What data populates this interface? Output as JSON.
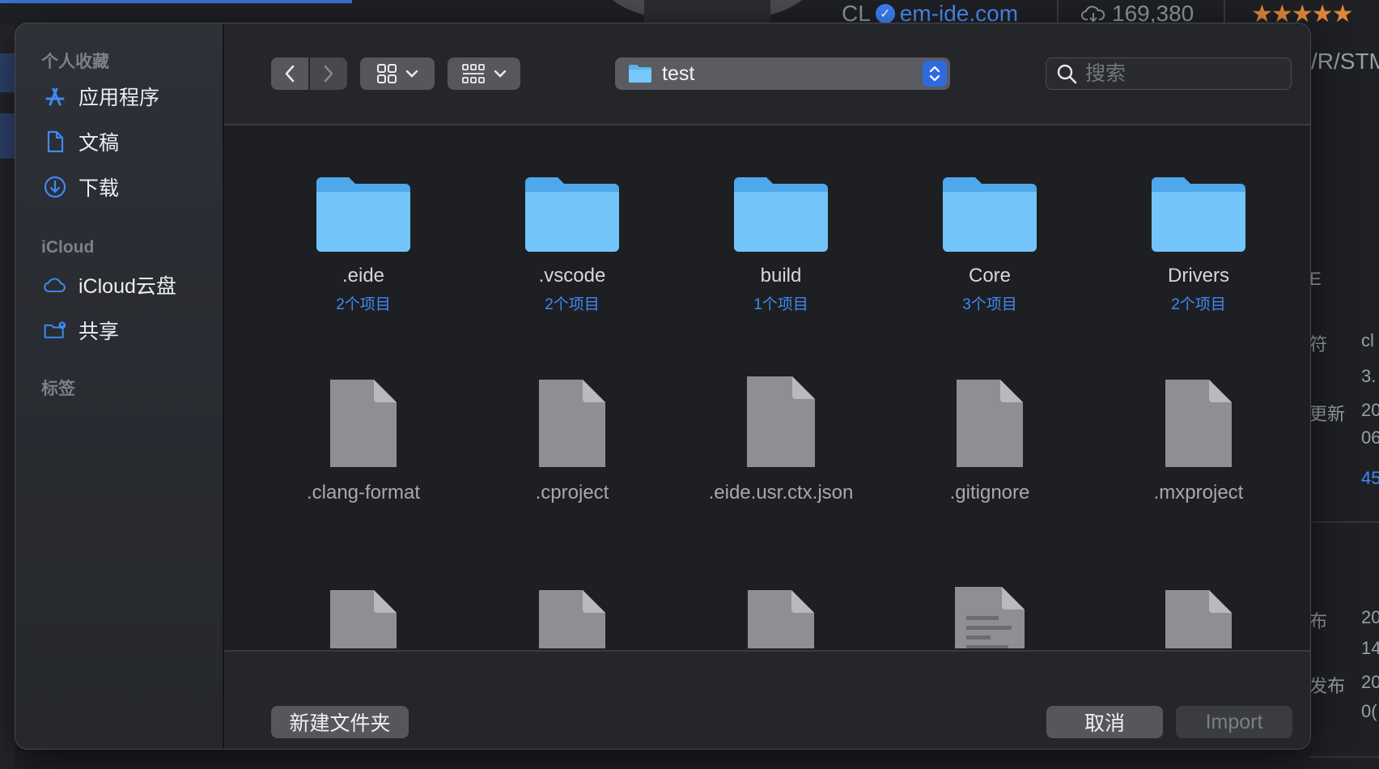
{
  "background": {
    "developer": "CL",
    "developer_link": "em-ide.com",
    "downloads": "169,380",
    "stars": "★★★★★",
    "partial_title": "/R/STM",
    "right_fragments": [
      "E",
      "符",
      "cl",
      "3.",
      "更新",
      "20",
      "06",
      "45",
      "布",
      "20",
      "14",
      "发布",
      "20",
      "0("
    ]
  },
  "sidebar": {
    "favorites_title": "个人收藏",
    "favorites": [
      {
        "label": "应用程序",
        "icon": "app-store-icon"
      },
      {
        "label": "文稿",
        "icon": "document-icon"
      },
      {
        "label": "下载",
        "icon": "download-icon"
      }
    ],
    "icloud_title": "iCloud",
    "icloud": [
      {
        "label": "iCloud云盘",
        "icon": "cloud-icon"
      },
      {
        "label": "共享",
        "icon": "shared-folder-icon"
      }
    ],
    "tags_title": "标签"
  },
  "toolbar": {
    "current_folder": "test",
    "search_placeholder": "搜索"
  },
  "items": [
    {
      "name": ".eide",
      "sub": "2个项目",
      "kind": "folder"
    },
    {
      "name": ".vscode",
      "sub": "2个项目",
      "kind": "folder"
    },
    {
      "name": "build",
      "sub": "1个项目",
      "kind": "folder"
    },
    {
      "name": "Core",
      "sub": "3个项目",
      "kind": "folder"
    },
    {
      "name": "Drivers",
      "sub": "2个项目",
      "kind": "folder"
    },
    {
      "name": ".clang-format",
      "kind": "file"
    },
    {
      "name": ".cproject",
      "kind": "file"
    },
    {
      "name": ".eide.usr.ctx.json",
      "kind": "file"
    },
    {
      "name": ".gitignore",
      "kind": "file"
    },
    {
      "name": ".mxproject",
      "kind": "file"
    }
  ],
  "footer": {
    "new_folder": "新建文件夹",
    "cancel": "取消",
    "import": "Import"
  },
  "colors": {
    "accent": "#2f6bde",
    "folder": "#6cc4f8",
    "link": "#3d8bf5"
  }
}
